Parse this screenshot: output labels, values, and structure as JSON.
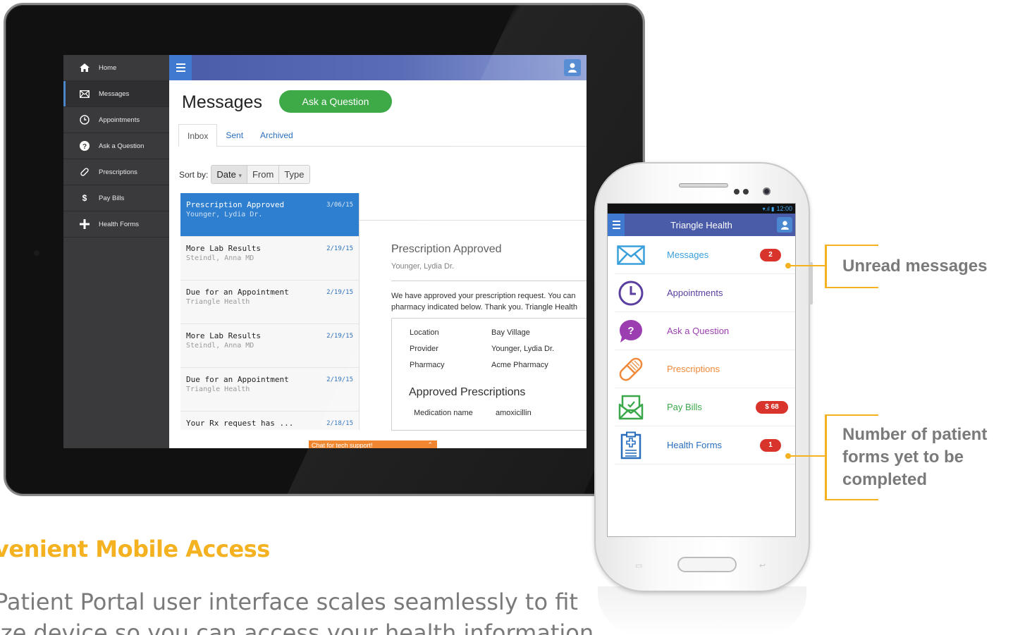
{
  "tablet": {
    "sidebar": [
      {
        "label": "Home",
        "icon": "home-icon"
      },
      {
        "label": "Messages",
        "icon": "envelope-icon"
      },
      {
        "label": "Appointments",
        "icon": "clock-icon"
      },
      {
        "label": "Ask a Question",
        "icon": "question-icon"
      },
      {
        "label": "Prescriptions",
        "icon": "pill-icon"
      },
      {
        "label": "Pay Bills",
        "icon": "dollar-icon"
      },
      {
        "label": "Health Forms",
        "icon": "plus-icon"
      }
    ],
    "header": {
      "title": "Messages",
      "ask_button": "Ask a Question"
    },
    "tabs": [
      "Inbox",
      "Sent",
      "Archived"
    ],
    "sort": {
      "label": "Sort by:",
      "options": [
        "Date",
        "From",
        "Type"
      ],
      "active_caret": "▾"
    },
    "messages": [
      {
        "subject": "Prescription Approved",
        "from": "Younger, Lydia Dr.",
        "date": "3/06/15"
      },
      {
        "subject": "More Lab Results",
        "from": "Steindl, Anna MD",
        "date": "2/19/15"
      },
      {
        "subject": "Due for an Appointment",
        "from": "Triangle Health",
        "date": "2/19/15"
      },
      {
        "subject": "More Lab Results",
        "from": "Steindl, Anna MD",
        "date": "2/19/15"
      },
      {
        "subject": "Due for an Appointment",
        "from": "Triangle Health",
        "date": "2/19/15"
      },
      {
        "subject": "Your Rx request has ...",
        "from": "",
        "date": "2/18/15"
      }
    ],
    "detail": {
      "title": "Prescription Approved",
      "sender": "Younger, Lydia Dr.",
      "body_line1": "We have approved your prescription request. You can",
      "body_line2": "pharmacy indicated below. Thank you. Triangle Health",
      "fields": [
        {
          "key": "Location",
          "value": "Bay Village"
        },
        {
          "key": "Provider",
          "value": "Younger, Lydia Dr."
        },
        {
          "key": "Pharmacy",
          "value": "Acme Pharmacy"
        }
      ],
      "approved_heading": "Approved Prescriptions",
      "med_key": "Medication name",
      "med_value": "amoxicillin"
    },
    "chat": {
      "label": "Chat for tech support!",
      "chevron": "⌃"
    }
  },
  "marketing": {
    "heading": "venient Mobile Access",
    "body_line1": "Patient Portal user interface scales seamlessly to fit",
    "body_line2": "ize device so you can access your health information"
  },
  "phone": {
    "status": {
      "signal": "▾.ıl ▮",
      "time": "12:00"
    },
    "title": "Triangle Health",
    "items": [
      {
        "label": "Messages",
        "color": "#3aa0dc",
        "icon": "envelope-icon",
        "badge": "2"
      },
      {
        "label": "Appointments",
        "color": "#5a3fa0",
        "icon": "clock-icon",
        "badge": ""
      },
      {
        "label": "Ask a Question",
        "color": "#9b3fb0",
        "icon": "question-bubble-icon",
        "badge": ""
      },
      {
        "label": "Prescriptions",
        "color": "#f08a3a",
        "icon": "pill-icon",
        "badge": ""
      },
      {
        "label": "Pay Bills",
        "color": "#3aa84a",
        "icon": "bill-envelope-icon",
        "badge": "$ 68"
      },
      {
        "label": "Health Forms",
        "color": "#2a6fbd",
        "icon": "clipboard-icon",
        "badge": "1"
      }
    ],
    "soft_keys": {
      "left": "▭",
      "right": "↩"
    }
  },
  "callouts": {
    "unread": "Unread messages",
    "forms_line1": "Number of patient",
    "forms_line2": "forms yet to be",
    "forms_line3": "completed"
  },
  "colors": {
    "accent_yellow": "#f4b120",
    "green": "#3daa47",
    "blue": "#2f7fd0",
    "badge_red": "#d9342b",
    "chat_orange": "#f07f23"
  }
}
